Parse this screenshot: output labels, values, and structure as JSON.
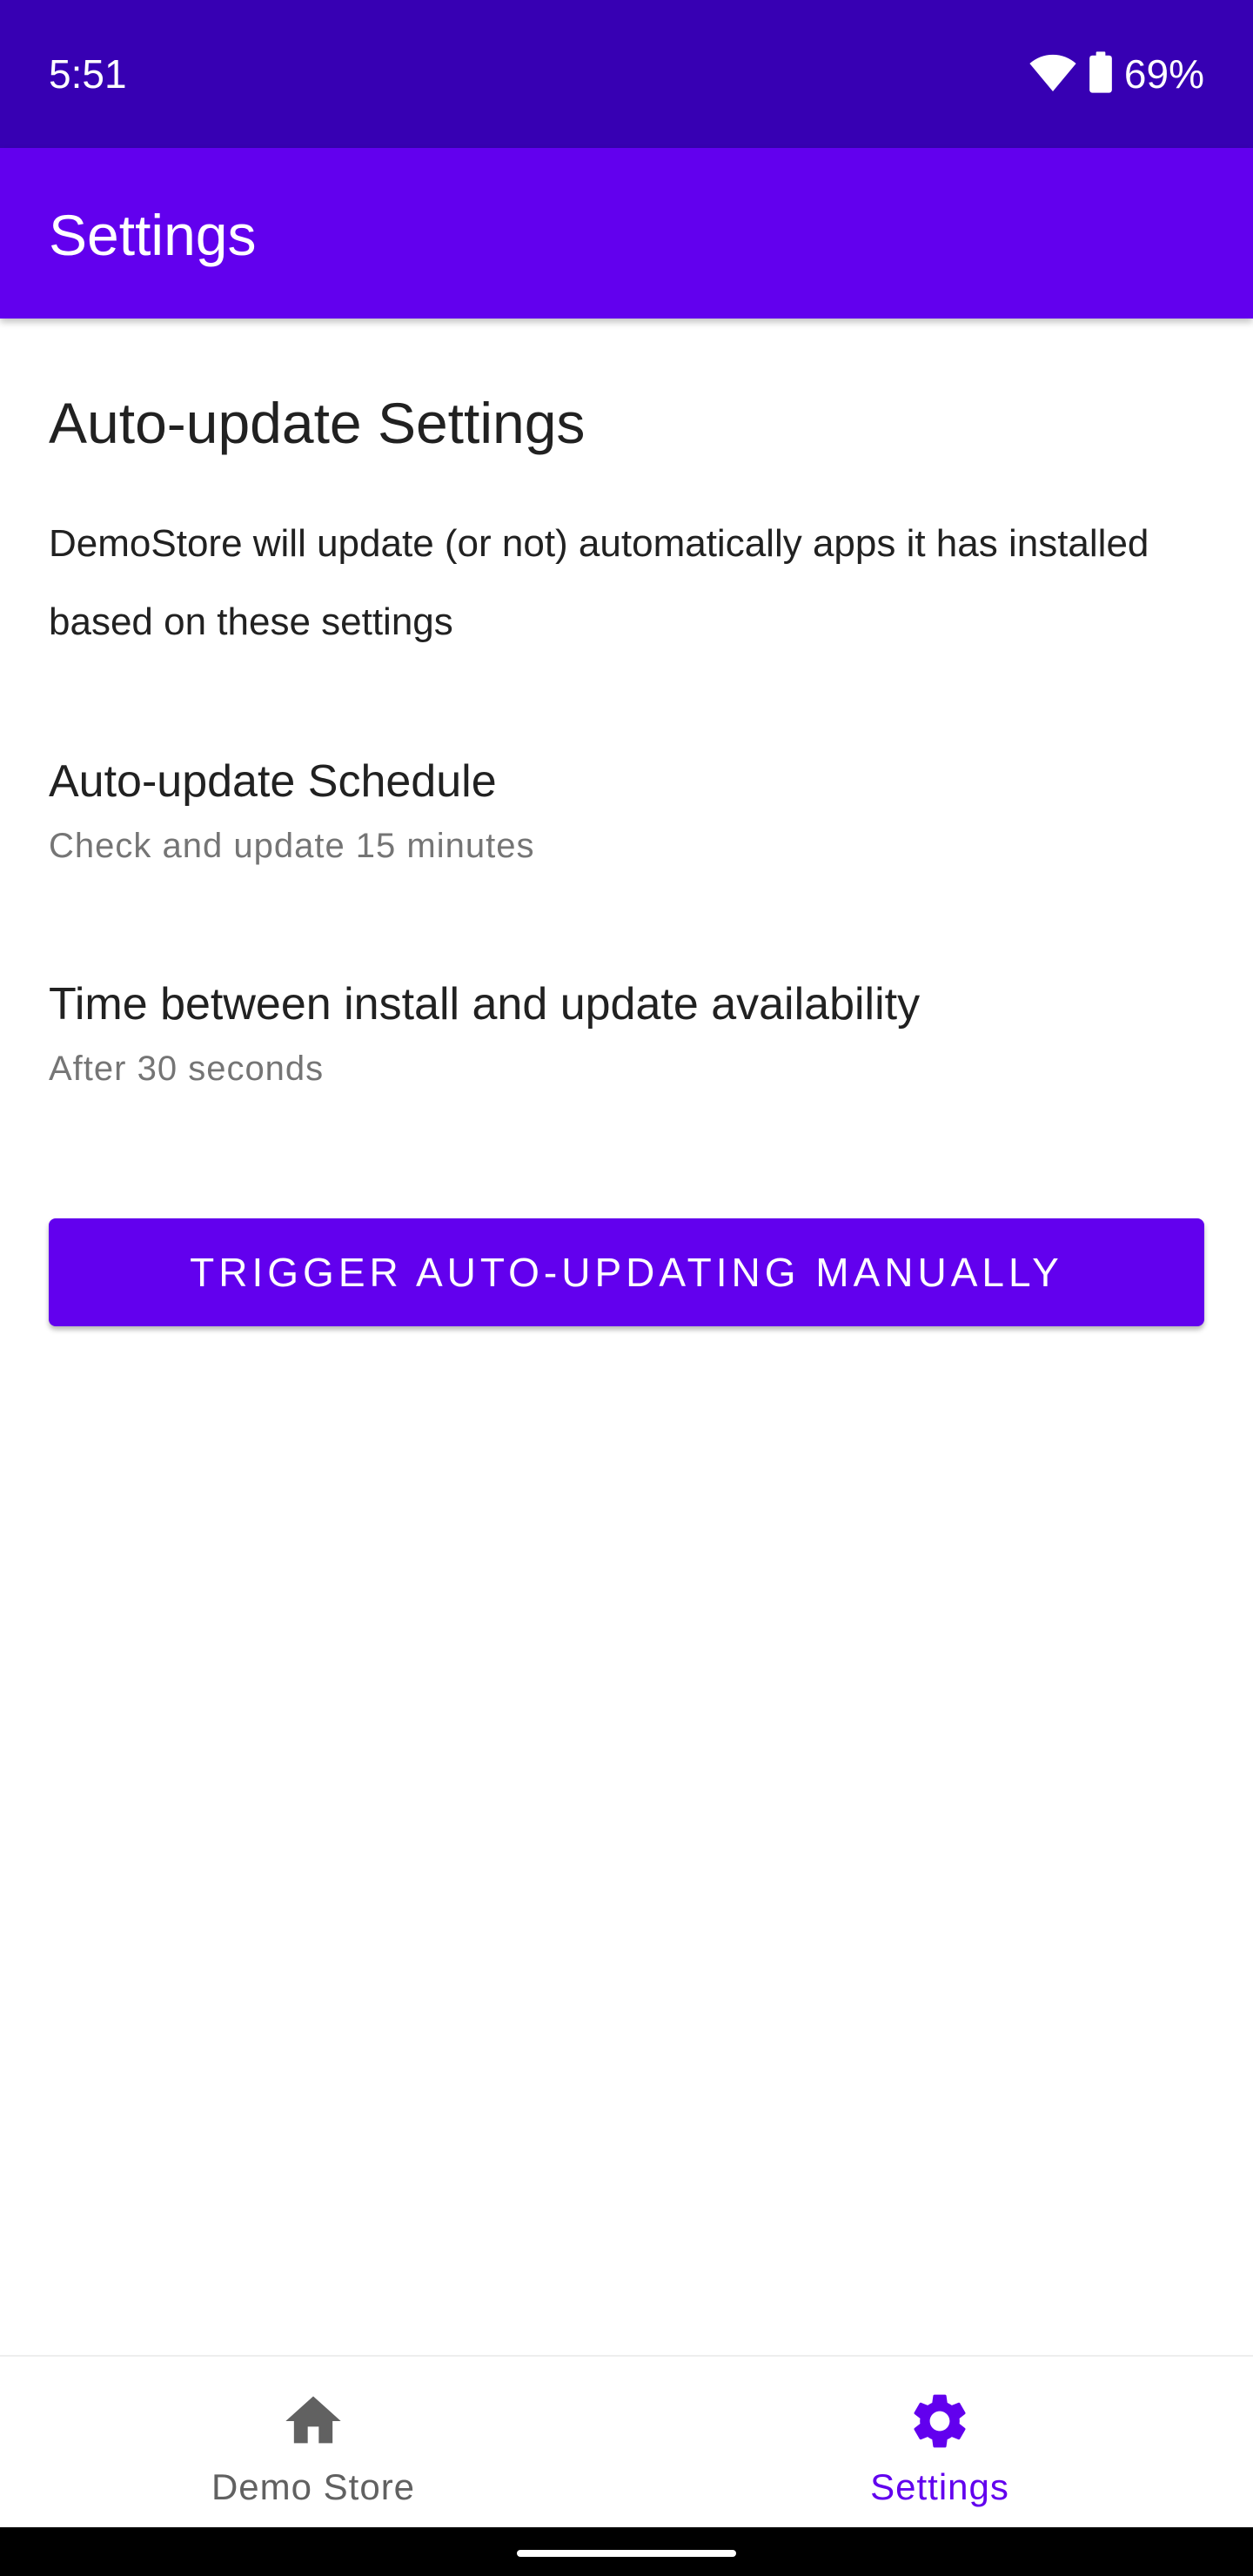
{
  "status_bar": {
    "time": "5:51",
    "battery": "69%",
    "icons": [
      "wifi-icon",
      "battery-icon"
    ]
  },
  "app_bar": {
    "title": "Settings"
  },
  "auto_update": {
    "title": "Auto-update Settings",
    "description": "DemoStore will update (or not) automatically apps it has installed based on these settings",
    "schedule": {
      "title": "Auto-update Schedule",
      "summary": "Check and update 15 minutes"
    },
    "delay": {
      "title": "Time between install and update availability",
      "summary": "After 30 seconds"
    },
    "trigger_button": "TRIGGER AUTO-UPDATING MANUALLY"
  },
  "bottom_nav": {
    "items": [
      {
        "label": "Demo Store",
        "icon": "home-icon",
        "active": false
      },
      {
        "label": "Settings",
        "icon": "gear-icon",
        "active": true
      }
    ]
  },
  "colors": {
    "status_bar": "#3700b3",
    "primary": "#6200ee",
    "text_primary": "#212121",
    "text_secondary": "#757575",
    "nav_inactive": "#616161"
  }
}
